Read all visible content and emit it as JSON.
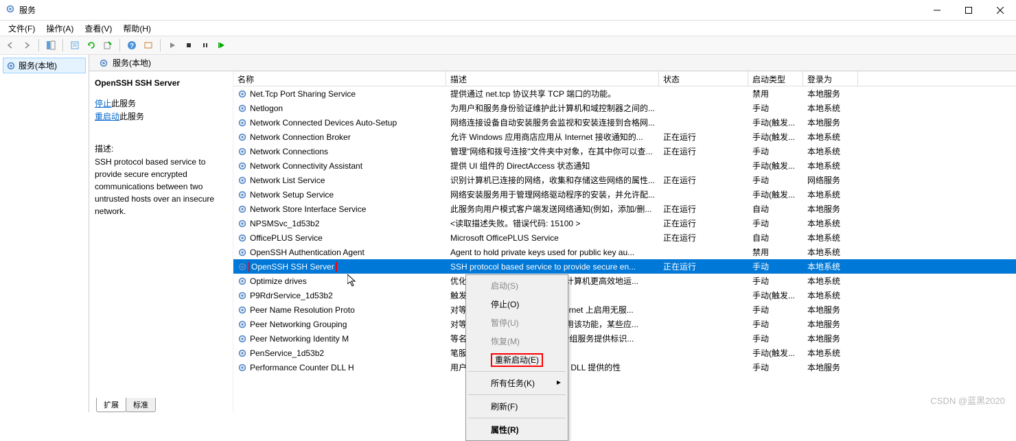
{
  "title": "服务",
  "menubar": [
    "文件(F)",
    "操作(A)",
    "查看(V)",
    "帮助(H)"
  ],
  "sidebar": {
    "item": "服务(本地)"
  },
  "main_header": "服务(本地)",
  "detail": {
    "name": "OpenSSH SSH Server",
    "stop_link": "停止",
    "stop_suffix": "此服务",
    "restart_link": "重启动",
    "restart_suffix": "此服务",
    "desc_label": "描述:",
    "desc_text": "SSH protocol based service to provide secure encrypted communications between two untrusted hosts over an insecure network."
  },
  "columns": {
    "name": "名称",
    "desc": "描述",
    "status": "状态",
    "startup": "启动类型",
    "logon": "登录为"
  },
  "rows": [
    {
      "name": "Net.Tcp Port Sharing Service",
      "desc": "提供通过 net.tcp 协议共享 TCP 端口的功能。",
      "status": "",
      "startup": "禁用",
      "logon": "本地服务"
    },
    {
      "name": "Netlogon",
      "desc": "为用户和服务身份验证维护此计算机和域控制器之间的...",
      "status": "",
      "startup": "手动",
      "logon": "本地系统"
    },
    {
      "name": "Network Connected Devices Auto-Setup",
      "desc": "网络连接设备自动安装服务会监视和安装连接到合格网...",
      "status": "",
      "startup": "手动(触发...",
      "logon": "本地服务"
    },
    {
      "name": "Network Connection Broker",
      "desc": "允许 Windows 应用商店应用从 Internet 接收通知的...",
      "status": "正在运行",
      "startup": "手动(触发...",
      "logon": "本地系统"
    },
    {
      "name": "Network Connections",
      "desc": "管理\"网络和拨号连接\"文件夹中对象，在其中你可以查...",
      "status": "正在运行",
      "startup": "手动",
      "logon": "本地系统"
    },
    {
      "name": "Network Connectivity Assistant",
      "desc": "提供 UI 组件的 DirectAccess 状态通知",
      "status": "",
      "startup": "手动(触发...",
      "logon": "本地系统"
    },
    {
      "name": "Network List Service",
      "desc": "识别计算机已连接的网络，收集和存储这些网络的属性...",
      "status": "正在运行",
      "startup": "手动",
      "logon": "网络服务"
    },
    {
      "name": "Network Setup Service",
      "desc": "网络安装服务用于管理网络驱动程序的安装，并允许配...",
      "status": "",
      "startup": "手动(触发...",
      "logon": "本地系统"
    },
    {
      "name": "Network Store Interface Service",
      "desc": "此服务向用户模式客户端发送网络通知(例如，添加/删...",
      "status": "正在运行",
      "startup": "自动",
      "logon": "本地服务"
    },
    {
      "name": "NPSMSvc_1d53b2",
      "desc": "<读取描述失败。错误代码: 15100 >",
      "status": "正在运行",
      "startup": "手动",
      "logon": "本地系统"
    },
    {
      "name": "OfficePLUS Service",
      "desc": "Microsoft OfficePLUS Service",
      "status": "正在运行",
      "startup": "自动",
      "logon": "本地系统"
    },
    {
      "name": "OpenSSH Authentication Agent",
      "desc": "Agent to hold private keys used for public key au...",
      "status": "",
      "startup": "禁用",
      "logon": "本地系统"
    },
    {
      "name": "OpenSSH SSH Server",
      "desc": "SSH protocol based service to provide secure en...",
      "status": "正在运行",
      "startup": "手动",
      "logon": "本地系统",
      "selected": true,
      "redbox": true
    },
    {
      "name": "Optimize drives",
      "desc": "优化存储驱动器上的文件来帮助计算机更高效地运...",
      "status": "",
      "startup": "手动",
      "logon": "本地系统"
    },
    {
      "name": "P9RdrService_1d53b2",
      "desc": "触发启动计划 9 文件服务器。",
      "status": "",
      "startup": "手动(触发...",
      "logon": "本地系统"
    },
    {
      "name": "Peer Name Resolution Proto",
      "desc": "对等名称解析协议(PNRP)在 Internet 上启用无服...",
      "status": "",
      "startup": "手动",
      "logon": "本地服务"
    },
    {
      "name": "Peer Networking Grouping",
      "desc": "对等分组启用多方通信。如果禁用该功能，某些应...",
      "status": "",
      "startup": "手动",
      "logon": "本地服务"
    },
    {
      "name": "Peer Networking Identity M",
      "desc": "等名称解析协议(PNRP)和对等分组服务提供标识...",
      "status": "",
      "startup": "手动",
      "logon": "本地服务"
    },
    {
      "name": "PenService_1d53b2",
      "desc": "笔服务",
      "status": "",
      "startup": "手动(触发...",
      "logon": "本地系统"
    },
    {
      "name": "Performance Counter DLL H",
      "desc": "用户和 64 位进程能够查询 32 位 DLL 提供的性",
      "status": "",
      "startup": "手动",
      "logon": "本地服务"
    }
  ],
  "context_menu": {
    "start": "启动(S)",
    "stop": "停止(O)",
    "pause": "暂停(U)",
    "resume": "恢复(M)",
    "restart": "重新启动(E)",
    "all_tasks": "所有任务(K)",
    "refresh": "刷新(F)",
    "properties": "属性(R)"
  },
  "tabs": {
    "extended": "扩展",
    "standard": "标准"
  },
  "watermark": "CSDN @蓝黑2020"
}
